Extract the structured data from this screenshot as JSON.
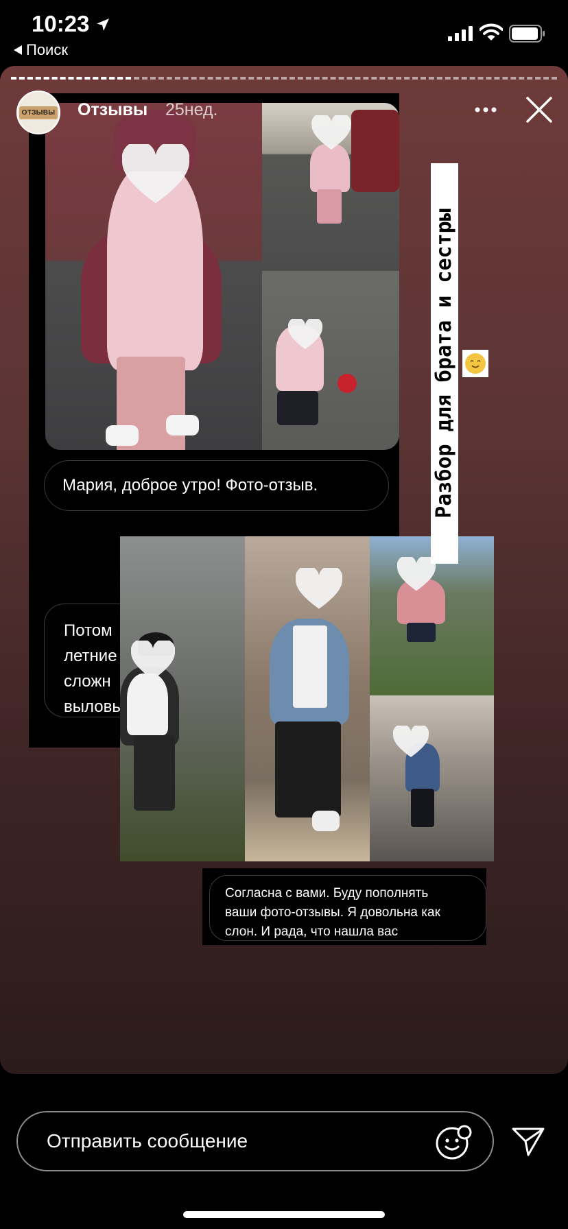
{
  "status_bar": {
    "time": "10:23",
    "back_label": "Поиск"
  },
  "story": {
    "account_name": "Отзывы",
    "avatar_label": "ОТЗЫВЫ",
    "age": "25нед.",
    "vertical_caption": "Разбор для брата и сестры",
    "messages": {
      "first": "Мария, доброе утро! Фото-отзыв.",
      "partial_lines": [
        "Потом",
        "летние",
        "сложн",
        "выловь"
      ],
      "caption_lines": [
        "Согласна с вами. Буду пополнять",
        "ваши фото-отзывы. Я довольна как",
        "слон. И рада, что нашла вас"
      ]
    }
  },
  "reply": {
    "placeholder": "Отправить сообщение"
  },
  "colors": {
    "story_bg_top": "#6e3a3a",
    "story_bg_bottom": "#2b1b1b",
    "heart": "#f2f2f2"
  },
  "icons": [
    "location-arrow-icon",
    "signal-icon",
    "wifi-icon",
    "battery-icon",
    "more-icon",
    "close-icon",
    "emoji-icon",
    "send-icon"
  ]
}
